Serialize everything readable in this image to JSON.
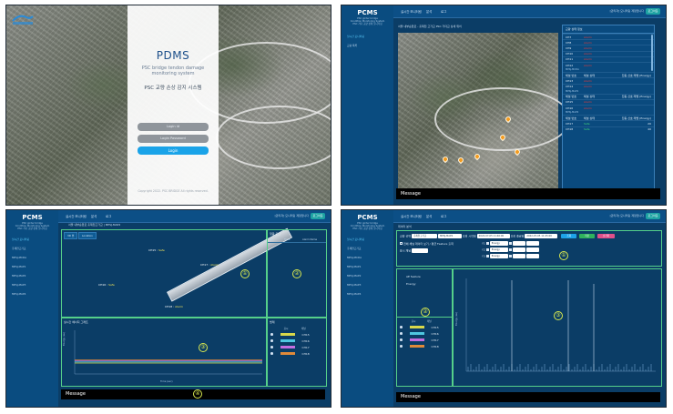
{
  "login": {
    "logo_text": "",
    "title": "PDMS",
    "subtitle_line1": "PSC bridge tendon damage",
    "subtitle_line2": "monitoring system",
    "korean_title": "PSC 교량 손상 감지 시스템",
    "login_id_placeholder": "Login id",
    "login_pw_placeholder": "Login Password",
    "login_button": "Login",
    "copyright": "Copyright 2022. PSC BRIDGE All rights reserved."
  },
  "app": {
    "brand": "PCMS",
    "brand_sub1": "PSC girder bridge",
    "brand_sub2": "Condition Monitoring System",
    "brand_sub3": "PSC 거더 교량 상태 모니터링",
    "nav": [
      "실시간 모니터링",
      "분석",
      "로그"
    ],
    "top_right": "[관리자] 모니터링 계정입니다",
    "top_button": "로그아웃",
    "message_label": "Message"
  },
  "p2": {
    "sidebar": [
      "실시간 모니터링",
      "교량 목록",
      "알람 발생 이력"
    ],
    "crumb": "서울 내부순환로 - 홍제천 고가교 PSC 거더교 상세 위치",
    "list_title": "교량 상태 정보",
    "groups": [
      "MPSJ-MCDA",
      "MPSJ-MAP1",
      "MPSJ-MAP2"
    ],
    "header": [
      "채널 번호",
      "채널 상태",
      "진동 신호 레벨 (Energy)"
    ],
    "rows": [
      {
        "ch": "CH7",
        "status": "Alarm",
        "ok": false,
        "val": ""
      },
      {
        "ch": "CH8",
        "status": "Alarm",
        "ok": false,
        "val": ""
      },
      {
        "ch": "CH9",
        "status": "Alarm",
        "ok": false,
        "val": ""
      },
      {
        "ch": "CH10",
        "status": "Alarm",
        "ok": false,
        "val": ""
      },
      {
        "ch": "CH11",
        "status": "Alarm",
        "ok": false,
        "val": ""
      },
      {
        "ch": "CH12",
        "status": "Alarm",
        "ok": false,
        "val": ""
      },
      {
        "ch": "CH13",
        "status": "Alarm",
        "ok": false,
        "val": ""
      },
      {
        "ch": "CH14",
        "status": "Alarm",
        "ok": false,
        "val": ""
      },
      {
        "ch": "CH15",
        "status": "Alarm",
        "ok": false,
        "val": ""
      },
      {
        "ch": "CH16",
        "status": "Alarm",
        "ok": false,
        "val": ""
      },
      {
        "ch": "CH17",
        "status": "Safe",
        "ok": true,
        "val": "20"
      },
      {
        "ch": "CH18",
        "status": "Safe",
        "ok": true,
        "val": "40"
      }
    ]
  },
  "p3": {
    "sidebar": [
      "실시간 모니터링",
      "홍제천고가교",
      "MPSJ-MCDA",
      "MPSJ-MAP1",
      "MPSJ-MAP2",
      "MPSJ-MAP3",
      "MPSJ-MAP4"
    ],
    "tabs": "서울 내부순환로 홍제천고가교 | MPSJ-MAP2",
    "subtabs": [
      "3D 뷰",
      "Location"
    ],
    "alarm_header": "알람 로그",
    "alarm_cols": [
      "ID",
      "Time",
      "Alarm Name"
    ],
    "ch_labels": [
      {
        "name": "CH15",
        "val": "Safe"
      },
      {
        "name": "CH17",
        "val": "Alarm"
      },
      {
        "name": "CH16",
        "val": "Safe"
      },
      {
        "name": "CH18",
        "val": "Alarm"
      }
    ],
    "chart_title": "실시간 에너지 그래프",
    "chart_ylabel": "Energy (au)",
    "chart_xlabel": "Time (sec)",
    "legend_header": "범례",
    "legend_cols": [
      "표시",
      "채널"
    ],
    "legend": [
      {
        "name": "CH15",
        "color": "#d8d84a"
      },
      {
        "name": "CH16",
        "color": "#4fc7e0"
      },
      {
        "name": "CH17",
        "color": "#c46ee0"
      },
      {
        "name": "CH18",
        "color": "#e08a3a"
      }
    ],
    "region_nums": [
      "①",
      "②",
      "③",
      "④"
    ]
  },
  "p4": {
    "sidebar": [
      "실시간 모니터링",
      "홍제천고가교",
      "MPSJ-MCDA",
      "MPSJ-MAP1",
      "MPSJ-MAP2",
      "MPSJ-MAP3",
      "MPSJ-MAP4"
    ],
    "crumb": "데이터 분석",
    "bridge_label": "교량 선택",
    "bridge_value": "홍제천고가교",
    "station_value": "MPSJ-MAP2",
    "period_label": "조회 시작일",
    "start_date": "2022-07-05 11:40:00",
    "end_label": "조회 종료일",
    "end_date": "2022-07-05 11:45:00",
    "chip_labels": [
      "조회",
      "저장",
      "초기화"
    ],
    "chip_colors": [
      "#1ea3e8",
      "#2fb35d",
      "#e0508a"
    ],
    "opt1": "전체 채널 데이터 보기 / 평균 Feature 출력",
    "opt2": "표시 채널",
    "param_rows": [
      "Y1",
      "Y2",
      "Y3"
    ],
    "param_value": "Energy",
    "feature_header": "AE feature",
    "feature_item": "Energy",
    "legend_cols": [
      "표시",
      "채널"
    ],
    "legend": [
      {
        "name": "CH15",
        "color": "#d8d84a"
      },
      {
        "name": "CH16",
        "color": "#4fc7e0"
      },
      {
        "name": "CH17",
        "color": "#c46ee0"
      },
      {
        "name": "CH18",
        "color": "#e08a3a"
      }
    ],
    "chart_ylabel": "Energy (au)",
    "region_nums": [
      "①",
      "②",
      "③"
    ]
  }
}
